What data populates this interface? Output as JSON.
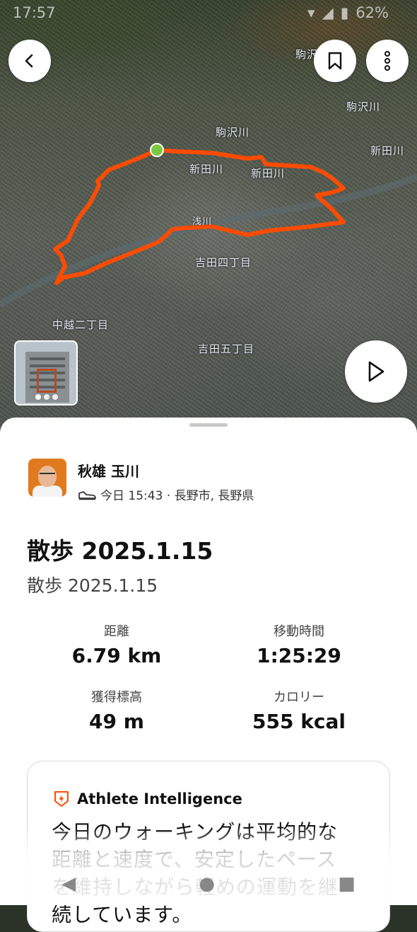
{
  "status_bar": {
    "time": "17:57",
    "battery": "62%"
  },
  "map": {
    "labels": [
      {
        "text": "駒沢川"
      },
      {
        "text": "駒沢川"
      },
      {
        "text": "新田川"
      },
      {
        "text": "新田川"
      },
      {
        "text": "新田川"
      },
      {
        "text": "吉田四丁目"
      },
      {
        "text": "中越二丁目"
      },
      {
        "text": "吉田五丁目"
      },
      {
        "text": "浅川"
      }
    ],
    "route_color": "#fc4c02",
    "start_marker_color": "#7bc742",
    "photo_count": 3
  },
  "activity": {
    "athlete_name": "秋雄 玉川",
    "meta": "今日 15:43 · 長野市, 長野県",
    "title": "散歩 2025.1.15",
    "description": "散歩 2025.1.15"
  },
  "stats": [
    {
      "label": "距離",
      "value": "6.79 km"
    },
    {
      "label": "移動時間",
      "value": "1:25:29"
    },
    {
      "label": "獲得標高",
      "value": "49 m"
    },
    {
      "label": "カロリー",
      "value": "555 kcal"
    }
  ],
  "athlete_intelligence": {
    "title": "Athlete Intelligence",
    "text": "今日のウォーキングは平均的な距離と速度で、安定したペースを維持しながら軽めの運動を継続しています。"
  },
  "colors": {
    "accent": "#fc4c02",
    "card_border": "#d7d7d7"
  },
  "icons": [
    "back-icon",
    "bookmark-icon",
    "more-vertical-icon",
    "play-icon",
    "shoe-icon",
    "athlete-intelligence-icon"
  ]
}
